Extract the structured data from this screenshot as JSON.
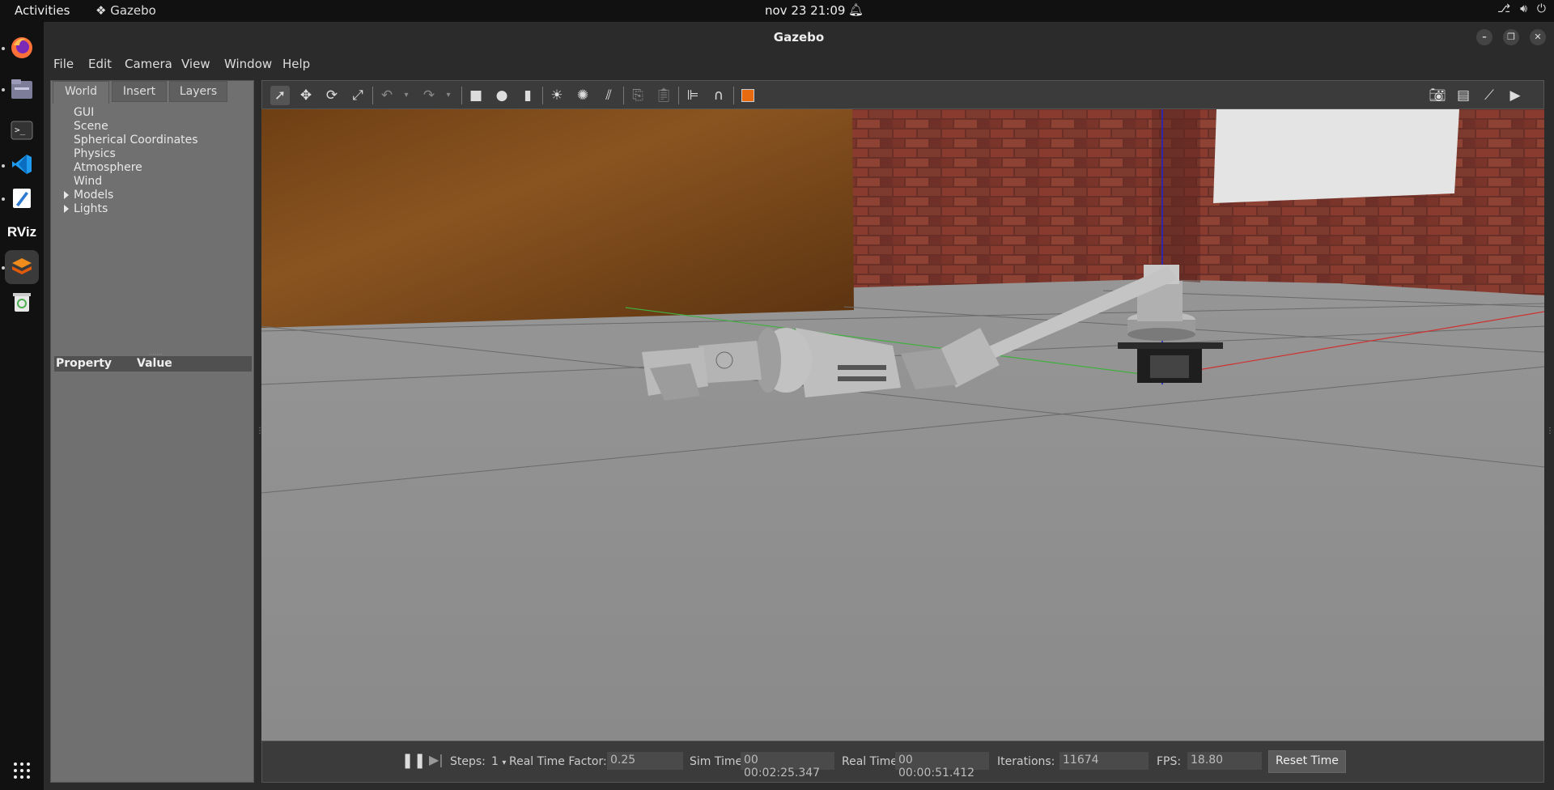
{
  "topbar": {
    "activities": "Activities",
    "app_name": "Gazebo",
    "clock": "nov 23  21:09"
  },
  "dock": {
    "items": [
      "firefox-icon",
      "files-icon",
      "terminal-icon",
      "vscode-icon",
      "text-editor-icon",
      "rviz-icon",
      "gazebo-icon",
      "trash-icon",
      "app-grid-icon"
    ],
    "rviz_label": "RViz"
  },
  "window": {
    "title": "Gazebo"
  },
  "menu": [
    "File",
    "Edit",
    "Camera",
    "View",
    "Window",
    "Help"
  ],
  "left_panel": {
    "tabs": [
      "World",
      "Insert",
      "Layers"
    ],
    "tree": [
      "GUI",
      "Scene",
      "Spherical Coordinates",
      "Physics",
      "Atmosphere",
      "Wind",
      "Models",
      "Lights"
    ],
    "property_header": "Property",
    "value_header": "Value"
  },
  "bottom": {
    "steps_label": "Steps:",
    "steps_value": "1",
    "rtf_label": "Real Time Factor:",
    "rtf_value": "0.25",
    "sim_time_label": "Sim Time:",
    "sim_time_value": "00 00:02:25.347",
    "real_time_label": "Real Time:",
    "real_time_value": "00 00:00:51.412",
    "iterations_label": "Iterations:",
    "iterations_value": "11674",
    "fps_label": "FPS:",
    "fps_value": "18.80",
    "reset_label": "Reset Time"
  },
  "colors": {
    "accent": "#e86a10",
    "x_axis": "#d03030",
    "y_axis": "#40b040",
    "z_axis": "#2020d0"
  }
}
